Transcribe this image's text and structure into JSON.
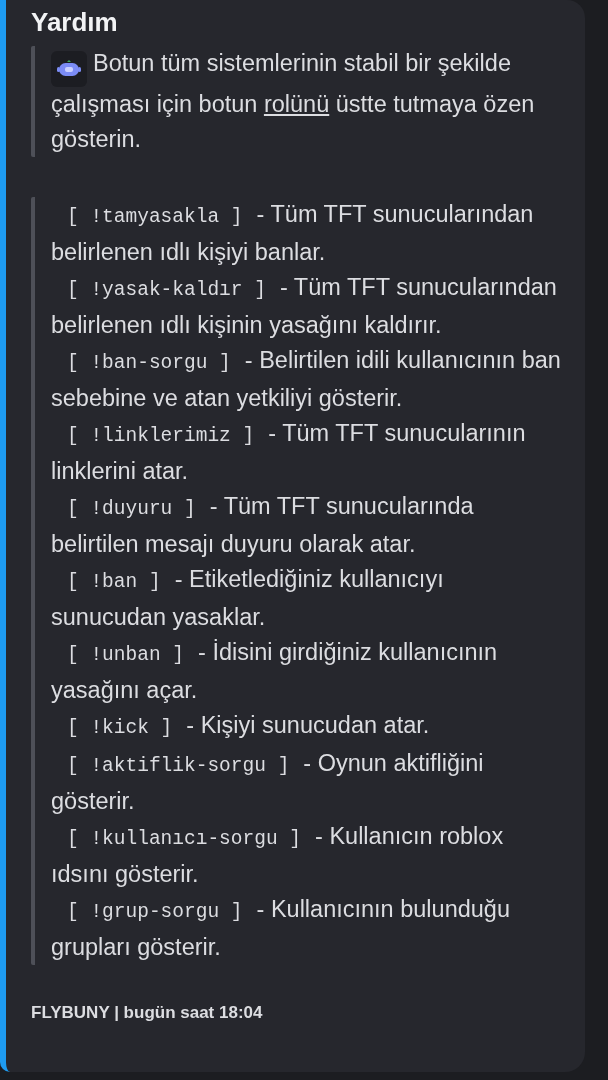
{
  "embed": {
    "title": "Yardım",
    "intro": [
      {
        "kind": "plain",
        "text": "Botun tüm sistemlerinin stabil bir şekilde çalışması için botun "
      },
      {
        "kind": "underlined",
        "text": "rolünü"
      },
      {
        "kind": "plain",
        "text": " üstte tutmaya özen gösterin."
      }
    ],
    "commands": [
      {
        "command": "[ !tamyasakla ]",
        "description": "- Tüm TFT sunucularından belirlenen ıdlı kişiyi banlar."
      },
      {
        "command": "[ !yasak-kaldır ]",
        "description": "- Tüm TFT sunucularından belirlenen ıdlı kişinin yasağını kaldırır."
      },
      {
        "command": "[ !ban-sorgu ]",
        "description": "- Belirtilen idili kullanıcının ban sebebine ve atan yetkiliyi gösterir."
      },
      {
        "command": "[ !linklerimiz ]",
        "description": "- Tüm TFT sunucularının linklerini atar."
      },
      {
        "command": "[ !duyuru ]",
        "description": "- Tüm TFT sunucularında belirtilen mesajı duyuru olarak atar."
      },
      {
        "command": "[ !ban ]",
        "description": "- Etiketlediğiniz kullanıcıyı sunucudan yasaklar."
      },
      {
        "command": "[ !unban ]",
        "description": "- İdisini girdiğiniz kullanıcının yasağını açar."
      },
      {
        "command": "[ !kick ]",
        "description": "- Kişiyi sunucudan atar."
      },
      {
        "command": "[ !aktiflik-sorgu ]",
        "description": "- Oynun aktifliğini gösterir."
      },
      {
        "command": "[ !kullanıcı-sorgu ]",
        "description": "- Kullanıcın roblox ıdsını gösterir."
      },
      {
        "command": "[ !grup-sorgu ]",
        "description": "- Kullanıcının bulunduğu grupları gösterir."
      }
    ],
    "footer": "FLYBUNY | bugün saat 18:04"
  }
}
